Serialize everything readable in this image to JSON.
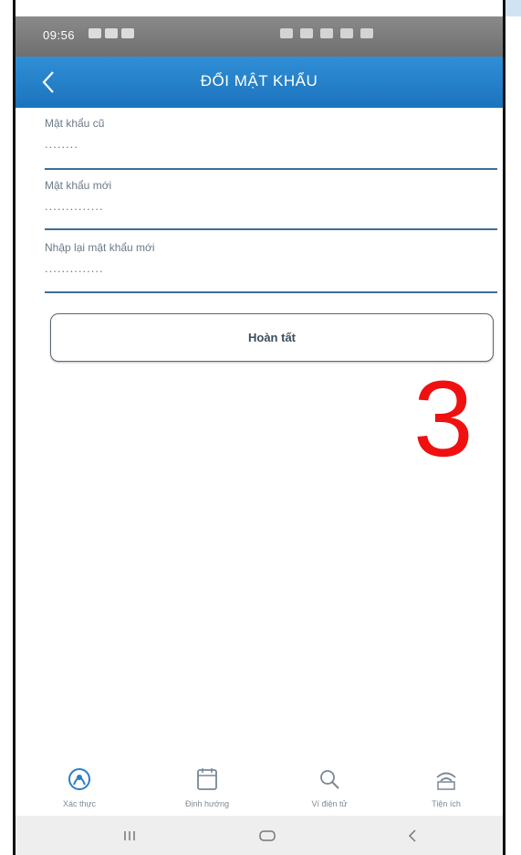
{
  "status_bar": {
    "time": "09:56"
  },
  "header": {
    "title": "ĐỔI MẬT KHẨU"
  },
  "form": {
    "fields": [
      {
        "label": "Mật khẩu cũ",
        "value": "........"
      },
      {
        "label": "Mật khẩu mới",
        "value": ".............."
      },
      {
        "label": "Nhập lại mật khẩu mới",
        "value": ".............."
      }
    ],
    "submit_label": "Hoàn tất"
  },
  "overlay": {
    "step_number": "3"
  },
  "bottom_nav": {
    "items": [
      {
        "label": "Xác thực",
        "icon": "fingerprint-shield-icon"
      },
      {
        "label": "Định hướng",
        "icon": "calendar-icon"
      },
      {
        "label": "Ví điện tử",
        "icon": "search-icon"
      },
      {
        "label": "Tiện ích",
        "icon": "wifi-icon"
      }
    ]
  },
  "colors": {
    "header": "#1c73bd",
    "field_line": "#3f6e95",
    "overlay_number": "#f01010"
  }
}
